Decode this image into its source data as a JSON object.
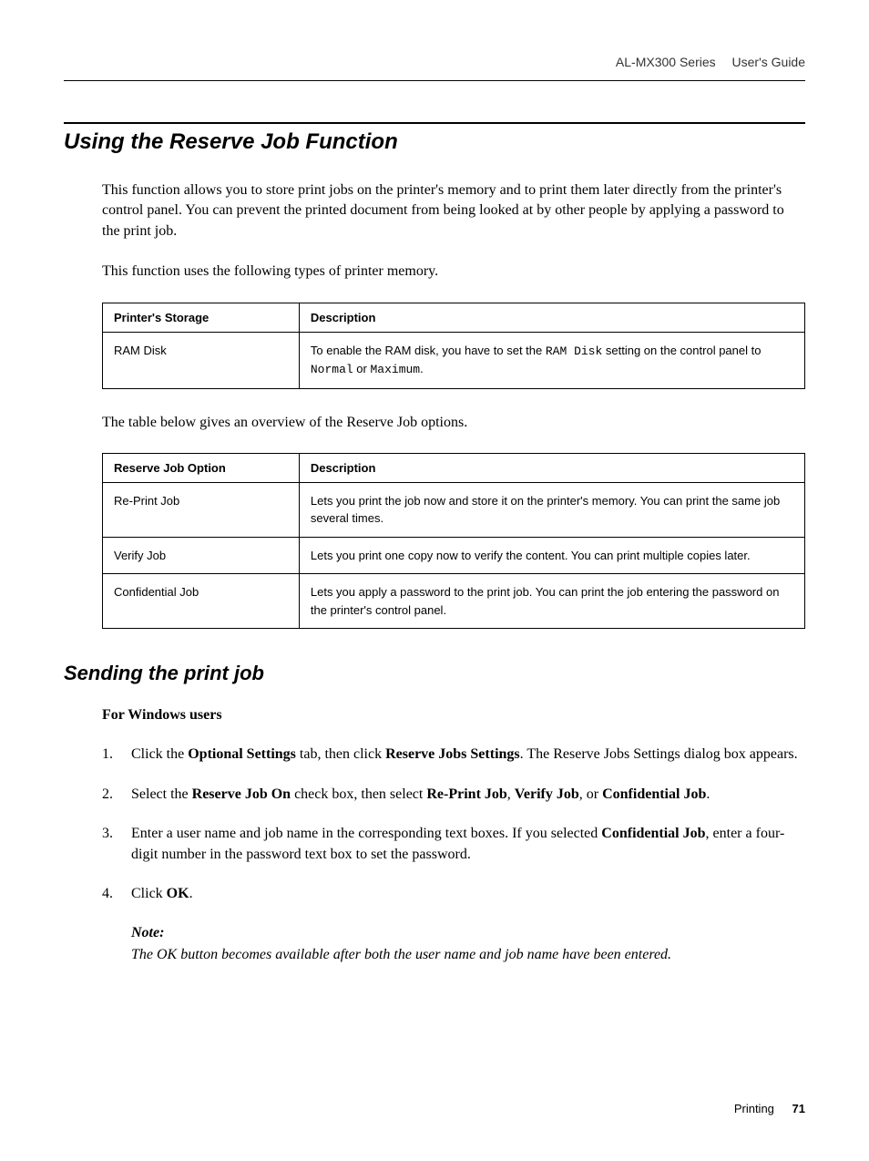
{
  "header": {
    "product": "AL-MX300 Series",
    "doc_type": "User's Guide"
  },
  "section_title": "Using the Reserve Job Function",
  "intro_para1": "This function allows you to store print jobs on the printer's memory and to print them later directly from the printer's control panel. You can prevent the printed document from being looked at by other people by applying a password to the print job.",
  "intro_para2": "This function uses the following types of printer memory.",
  "table1": {
    "headers": [
      "Printer's Storage",
      "Description"
    ],
    "rows": [
      {
        "col1": "RAM Disk",
        "col2_segments": [
          {
            "text": "To enable the RAM disk, you have to set the ",
            "mono": false
          },
          {
            "text": "RAM Disk",
            "mono": true
          },
          {
            "text": " setting on the control panel to ",
            "mono": false
          },
          {
            "text": "Normal",
            "mono": true
          },
          {
            "text": " or ",
            "mono": false
          },
          {
            "text": "Maximum",
            "mono": true
          },
          {
            "text": ".",
            "mono": false
          }
        ]
      }
    ]
  },
  "table_intro": "The table below gives an overview of the Reserve Job options.",
  "table2": {
    "headers": [
      "Reserve Job Option",
      "Description"
    ],
    "rows": [
      {
        "col1": "Re-Print Job",
        "col2": "Lets you print the job now and store it on the printer's memory. You can print the same job several times."
      },
      {
        "col1": "Verify Job",
        "col2": "Lets you print one copy now to verify the content. You can print multiple copies later."
      },
      {
        "col1": "Confidential Job",
        "col2": "Lets you apply a password to the print job. You can print the job entering the password on the printer's control panel."
      }
    ]
  },
  "subsection_title": "Sending the print job",
  "sub_heading": "For Windows users",
  "steps": [
    {
      "segments": [
        {
          "text": "Click the ",
          "bold": false
        },
        {
          "text": "Optional Settings",
          "bold": true
        },
        {
          "text": " tab, then click ",
          "bold": false
        },
        {
          "text": "Reserve Jobs Settings",
          "bold": true
        },
        {
          "text": ". The Reserve Jobs Settings dialog box appears.",
          "bold": false
        }
      ]
    },
    {
      "segments": [
        {
          "text": "Select the ",
          "bold": false
        },
        {
          "text": "Reserve Job On",
          "bold": true
        },
        {
          "text": " check box, then select ",
          "bold": false
        },
        {
          "text": "Re-Print Job",
          "bold": true
        },
        {
          "text": ", ",
          "bold": false
        },
        {
          "text": "Verify Job",
          "bold": true
        },
        {
          "text": ", or ",
          "bold": false
        },
        {
          "text": "Confidential Job",
          "bold": true
        },
        {
          "text": ".",
          "bold": false
        }
      ]
    },
    {
      "segments": [
        {
          "text": "Enter a user name and job name in the corresponding text boxes. If you selected ",
          "bold": false
        },
        {
          "text": "Confidential Job",
          "bold": true
        },
        {
          "text": ", enter a four-digit number in the password text box to set the password.",
          "bold": false
        }
      ]
    },
    {
      "segments": [
        {
          "text": "Click ",
          "bold": false
        },
        {
          "text": "OK",
          "bold": true
        },
        {
          "text": ".",
          "bold": false
        }
      ]
    }
  ],
  "note": {
    "label": "Note:",
    "text": "The OK button becomes available after both the user name and job name have been entered."
  },
  "footer": {
    "section": "Printing",
    "page": "71"
  }
}
